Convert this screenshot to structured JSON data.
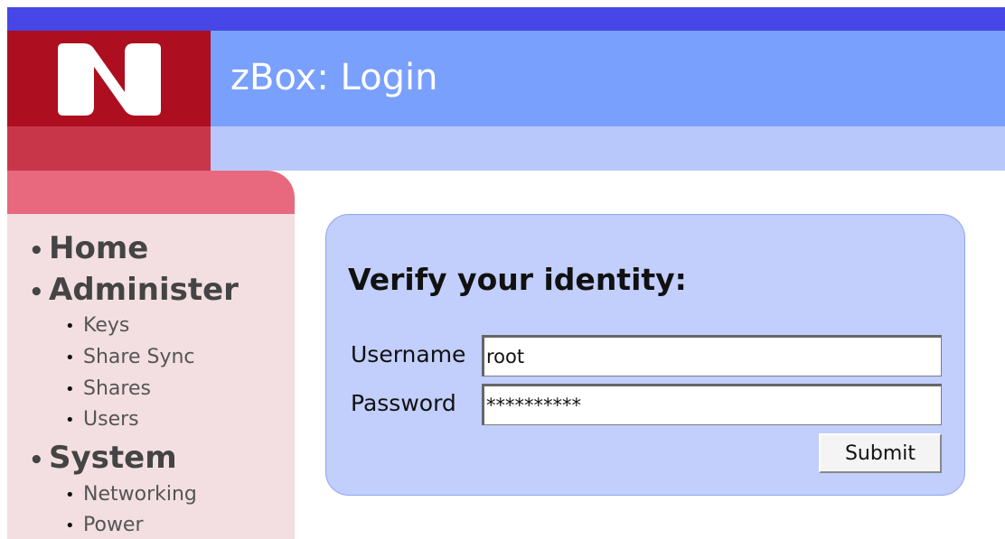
{
  "header": {
    "title": "zBox: Login",
    "logo_icon": "zbox-logo-icon"
  },
  "sidebar": {
    "sections": [
      {
        "label": "Home",
        "items": []
      },
      {
        "label": "Administer",
        "items": [
          "Keys",
          "Share Sync",
          "Shares",
          "Users"
        ]
      },
      {
        "label": "System",
        "items": [
          "Networking",
          "Power"
        ]
      }
    ]
  },
  "login": {
    "heading": "Verify your identity:",
    "username_label": "Username",
    "username_value": "root",
    "password_label": "Password",
    "password_value": "**********",
    "submit_label": "Submit"
  },
  "colors": {
    "accent_bar": "#4747e8",
    "header_main": "#7aa0fd",
    "header_sub": "#b8c8fb",
    "logo_bg": "#ad0e20",
    "sidebar_bg": "#f3dfe1",
    "panel_bg": "#c2cefb"
  }
}
